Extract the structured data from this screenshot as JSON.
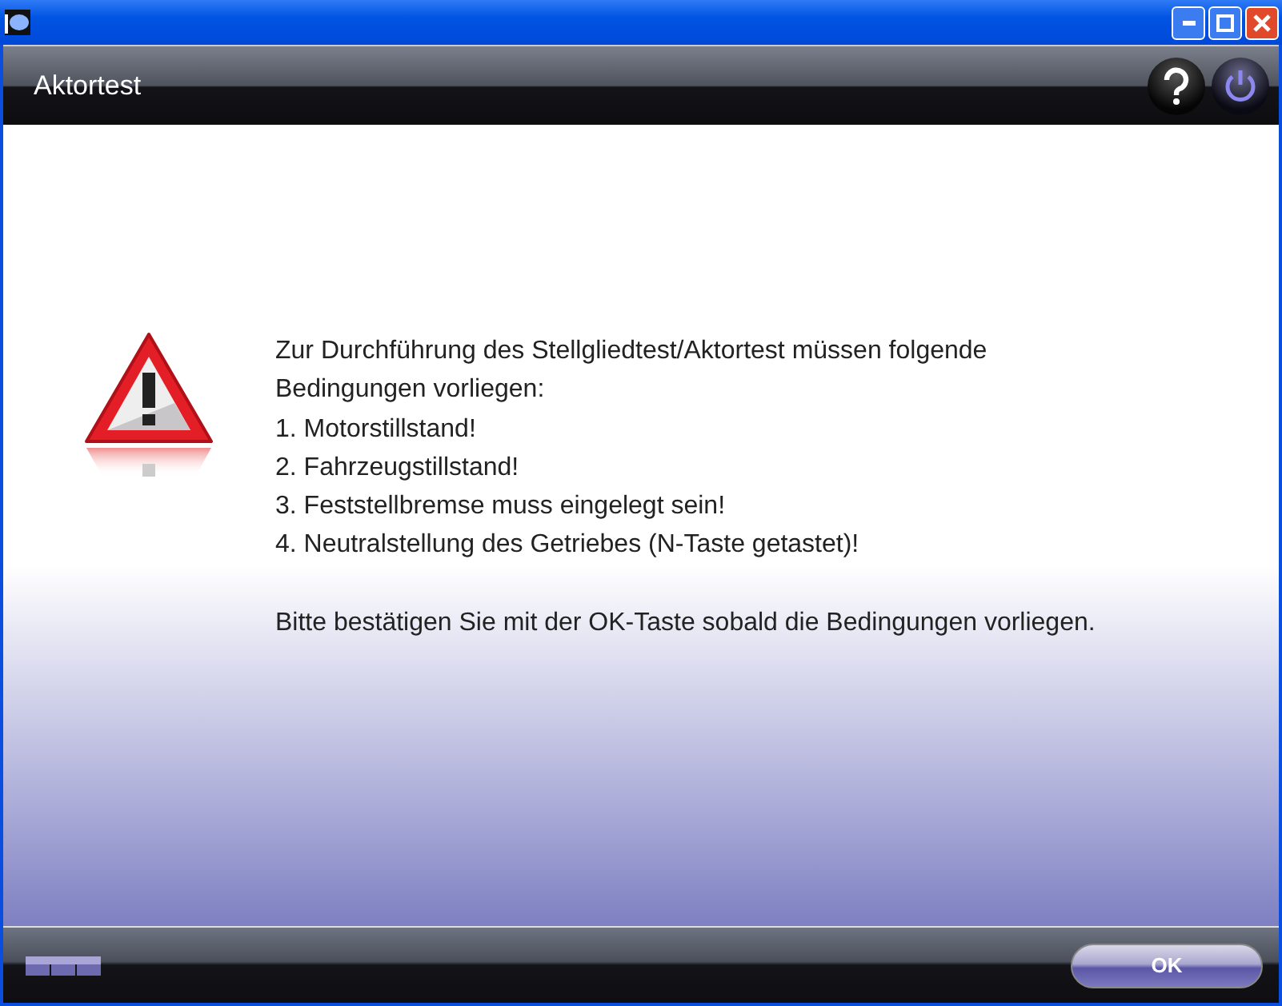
{
  "header": {
    "title": "Aktortest"
  },
  "message": {
    "lines": [
      "Zur Durchführung des Stellgliedtest/Aktortest müssen folgende Bedingungen vorliegen:",
      "1. Motorstillstand!",
      "2. Fahrzeugstillstand!",
      "3. Feststellbremse muss eingelegt sein!",
      "4. Neutralstellung des Getriebes (N-Taste getastet)!"
    ],
    "confirmation": "Bitte bestätigen Sie mit der OK-Taste sobald die Bedingungen vorliegen."
  },
  "footer": {
    "ok_button": "OK"
  }
}
